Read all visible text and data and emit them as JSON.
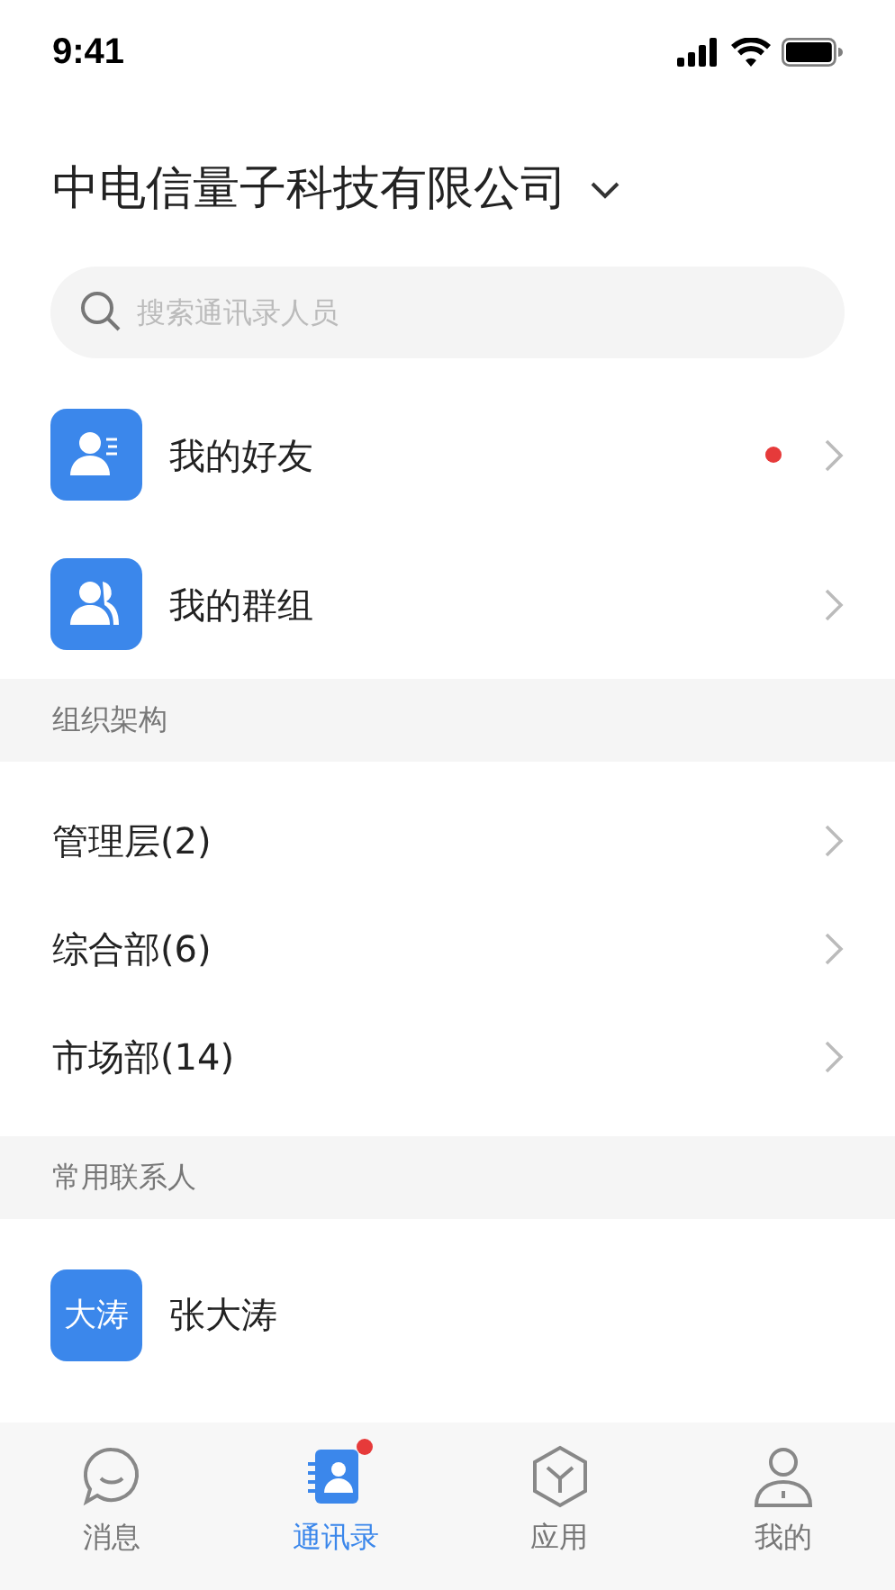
{
  "status_bar": {
    "time": "9:41"
  },
  "header": {
    "title": "中电信量子科技有限公司"
  },
  "search": {
    "placeholder": "搜索通讯录人员"
  },
  "quick_items": [
    {
      "kind": "friends",
      "label": "我的好友",
      "badge": true
    },
    {
      "kind": "groups",
      "label": "我的群组",
      "badge": false
    }
  ],
  "org_section": {
    "title": "组织架构",
    "items": [
      {
        "label": "管理层(2)"
      },
      {
        "label": "综合部(6)"
      },
      {
        "label": "市场部(14)"
      }
    ]
  },
  "contacts_section": {
    "title": "常用联系人",
    "items": [
      {
        "avatar": "大涛",
        "name": "张大涛"
      }
    ]
  },
  "tabs": [
    {
      "kind": "messages",
      "label": "消息",
      "selected": false,
      "badge": false
    },
    {
      "kind": "contacts",
      "label": "通讯录",
      "selected": true,
      "badge": true
    },
    {
      "kind": "apps",
      "label": "应用",
      "selected": false,
      "badge": false
    },
    {
      "kind": "me",
      "label": "我的",
      "selected": false,
      "badge": false
    }
  ]
}
